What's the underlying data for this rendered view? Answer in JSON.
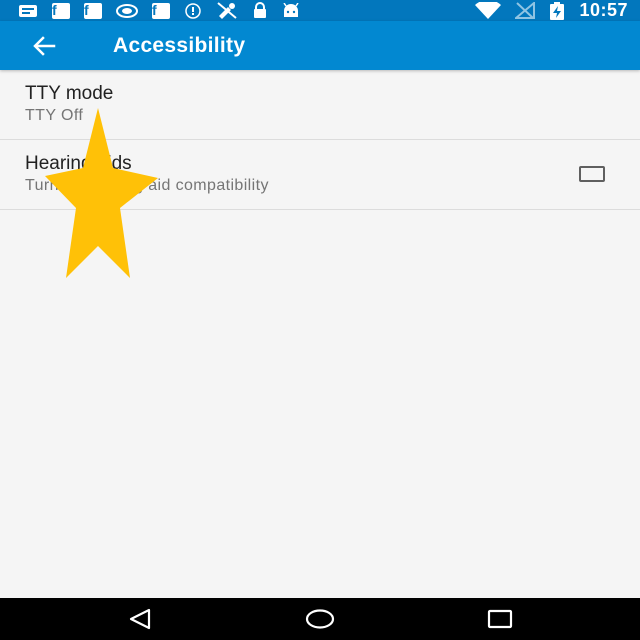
{
  "status_bar": {
    "time": "10:57",
    "left_icons": [
      "message-icon",
      "facebook-icon",
      "facebook-icon",
      "nvidia-icon",
      "facebook-icon",
      "alert-icon",
      "no-satellite-icon",
      "lock-icon",
      "android-icon"
    ],
    "right_icons": [
      "wifi-icon",
      "no-signal-icon",
      "battery-charging-icon"
    ],
    "facebook_letter": "f"
  },
  "app_bar": {
    "title": "Accessibility",
    "background": "#0288d1"
  },
  "preferences": [
    {
      "title": "TTY mode",
      "summary": "TTY Off"
    },
    {
      "title": "Hearing aids",
      "summary": "Turn on hearing aid compatibility",
      "checked": false
    }
  ],
  "overlay": {
    "icon": "star-icon",
    "color": "#ffc107"
  },
  "colors": {
    "status_bar": "#0277bd",
    "app_bar": "#0288d1",
    "background": "#f5f5f5"
  },
  "nav_bar": {
    "buttons": [
      "back-triangle-icon",
      "home-circle-icon",
      "recents-square-icon"
    ]
  }
}
